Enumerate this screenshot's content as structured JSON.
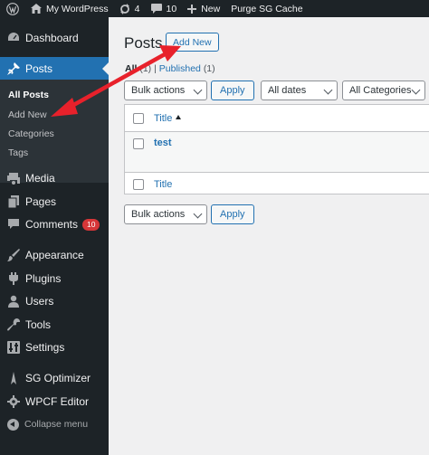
{
  "adminbar": {
    "site_name": "My WordPress",
    "updates_count": "4",
    "comments_count": "10",
    "new_label": "New",
    "purge_label": "Purge SG Cache"
  },
  "sidebar": {
    "dashboard": "Dashboard",
    "posts": "Posts",
    "submenu": [
      "All Posts",
      "Add New",
      "Categories",
      "Tags"
    ],
    "media": "Media",
    "pages": "Pages",
    "comments": "Comments",
    "comments_badge": "10",
    "appearance": "Appearance",
    "plugins": "Plugins",
    "users": "Users",
    "tools": "Tools",
    "settings": "Settings",
    "sg_optimizer": "SG Optimizer",
    "wpcf_editor": "WPCF Editor",
    "collapse": "Collapse menu"
  },
  "main": {
    "title": "Posts",
    "add_new": "Add New",
    "filter_all": "All",
    "filter_all_count": "(1)",
    "filter_separator": "|",
    "filter_published": "Published",
    "filter_published_count": "(1)",
    "bulk_actions_top": "Bulk actions",
    "apply_top": "Apply",
    "dates_filter": "All dates",
    "categories_filter": "All Categories",
    "table": {
      "column_title": "Title",
      "rows": [
        {
          "title": "test"
        }
      ],
      "footer_title": "Title"
    },
    "bulk_actions_bottom": "Bulk actions",
    "apply_bottom": "Apply"
  },
  "colors": {
    "admin_dark": "#1d2327",
    "accent_blue": "#2271b1",
    "annotation_red": "#e8212b",
    "badge_red": "#d63638"
  }
}
